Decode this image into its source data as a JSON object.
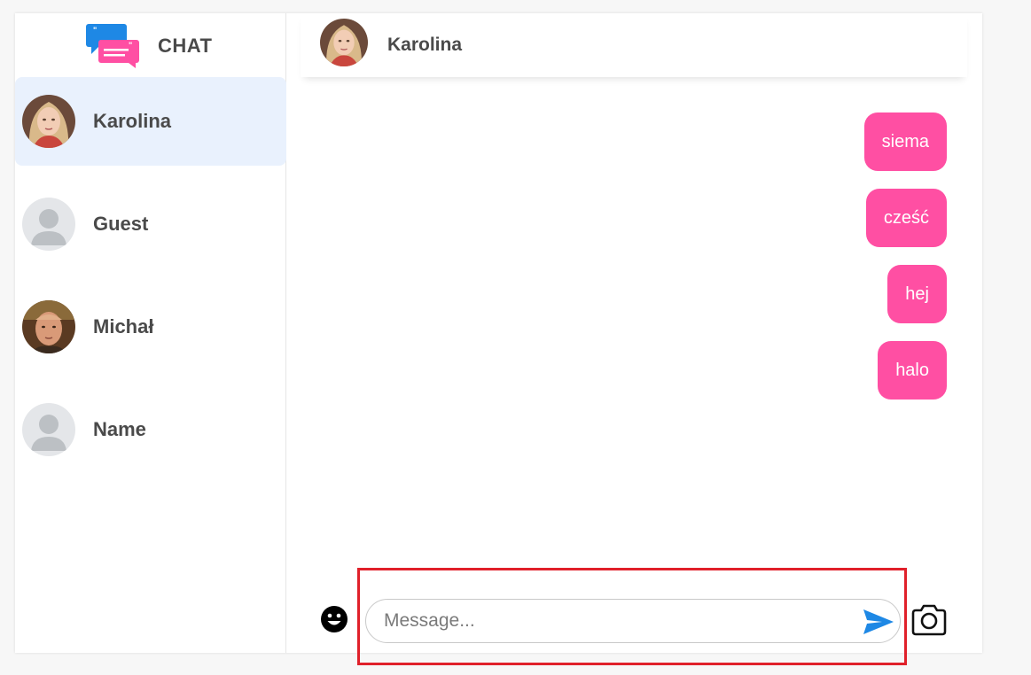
{
  "app": {
    "title": "CHAT",
    "accent": "#ff4fa3",
    "active_bg": "#e9f1fd",
    "send_color": "#1e88e5"
  },
  "contacts": [
    {
      "name": "Karolina",
      "avatar": "photo-woman-blonde",
      "active": true
    },
    {
      "name": "Guest",
      "avatar": "default-user-icon",
      "active": false
    },
    {
      "name": "Michał",
      "avatar": "photo-man",
      "active": false
    },
    {
      "name": "Name",
      "avatar": "default-user-icon",
      "active": false
    }
  ],
  "chat": {
    "recipient": "Karolina",
    "messages": [
      {
        "text": "siema",
        "from": "me"
      },
      {
        "text": "cześć",
        "from": "me"
      },
      {
        "text": "hej",
        "from": "me"
      },
      {
        "text": "halo",
        "from": "me"
      }
    ]
  },
  "composer": {
    "placeholder": "Message...",
    "value": "",
    "emoji_icon": "smiley-icon",
    "send_icon": "send-arrow-icon",
    "camera_icon": "camera-icon"
  }
}
